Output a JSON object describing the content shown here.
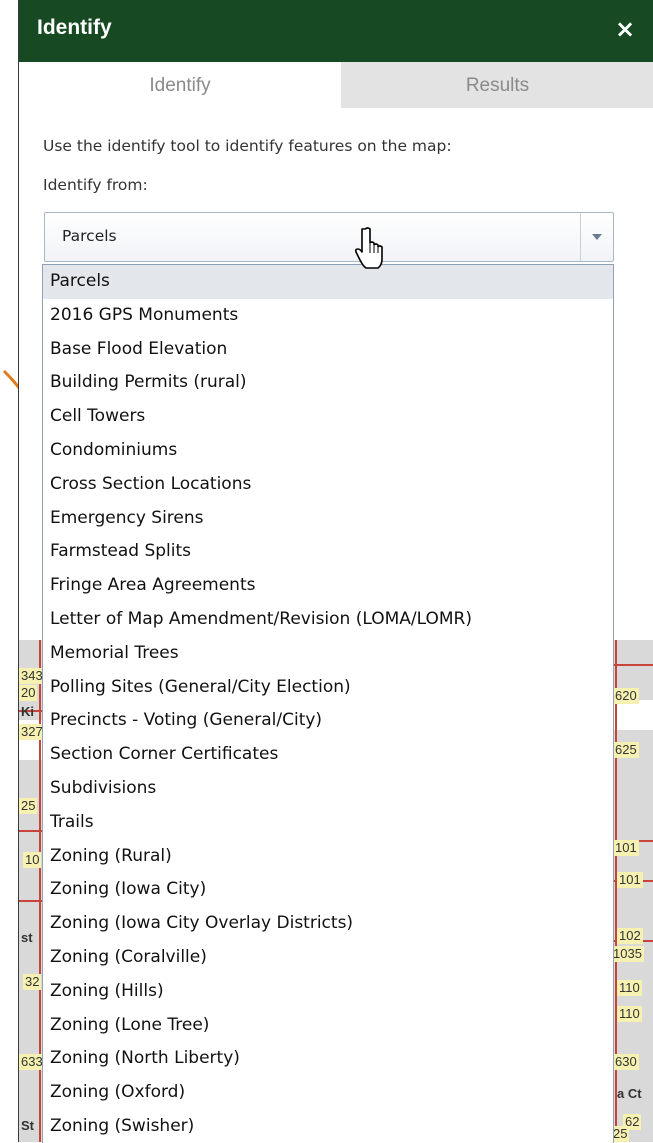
{
  "panel": {
    "title": "Identify",
    "close_label": "×"
  },
  "tabs": [
    {
      "label": "Identify",
      "active": true
    },
    {
      "label": "Results",
      "active": false
    }
  ],
  "form": {
    "instructions": "Use the identify tool to identify features on the map:",
    "identify_from_label": "Identify from:",
    "selected_value": "Parcels"
  },
  "dropdown_options": [
    "Parcels",
    "2016 GPS Monuments",
    "Base Flood Elevation",
    "Building Permits (rural)",
    "Cell Towers",
    "Condominiums",
    "Cross Section Locations",
    "Emergency Sirens",
    "Farmstead Splits",
    "Fringe Area Agreements",
    "Letter of Map Amendment/Revision (LOMA/LOMR)",
    "Memorial Trees",
    "Polling Sites (General/City Election)",
    "Precincts - Voting (General/City)",
    "Section Corner Certificates",
    "Subdivisions",
    "Trails",
    "Zoning (Rural)",
    "Zoning (Iowa City)",
    "Zoning (Iowa City Overlay Districts)",
    "Zoning (Coralville)",
    "Zoning (Hills)",
    "Zoning (Lone Tree)",
    "Zoning (North Liberty)",
    "Zoning (Oxford)",
    "Zoning (Swisher)"
  ],
  "map_labels_left": [
    "343",
    "20",
    "Ki",
    "327",
    "25",
    "10",
    "st",
    "32",
    "633",
    "St"
  ],
  "map_labels_right": [
    "620",
    "625",
    "101",
    "101",
    "102",
    "1035",
    "110",
    "110",
    "630",
    "a Ct",
    "62",
    "25"
  ],
  "colors": {
    "header_bg": "#174a22",
    "annotation_arrow": "#e07a1c",
    "selected_option_bg": "#e3e6ea"
  },
  "icons": {
    "close": "close-icon",
    "dropdown": "chevron-down-icon",
    "cursor": "hand-pointer-icon",
    "annotation": "arrow-icon"
  }
}
